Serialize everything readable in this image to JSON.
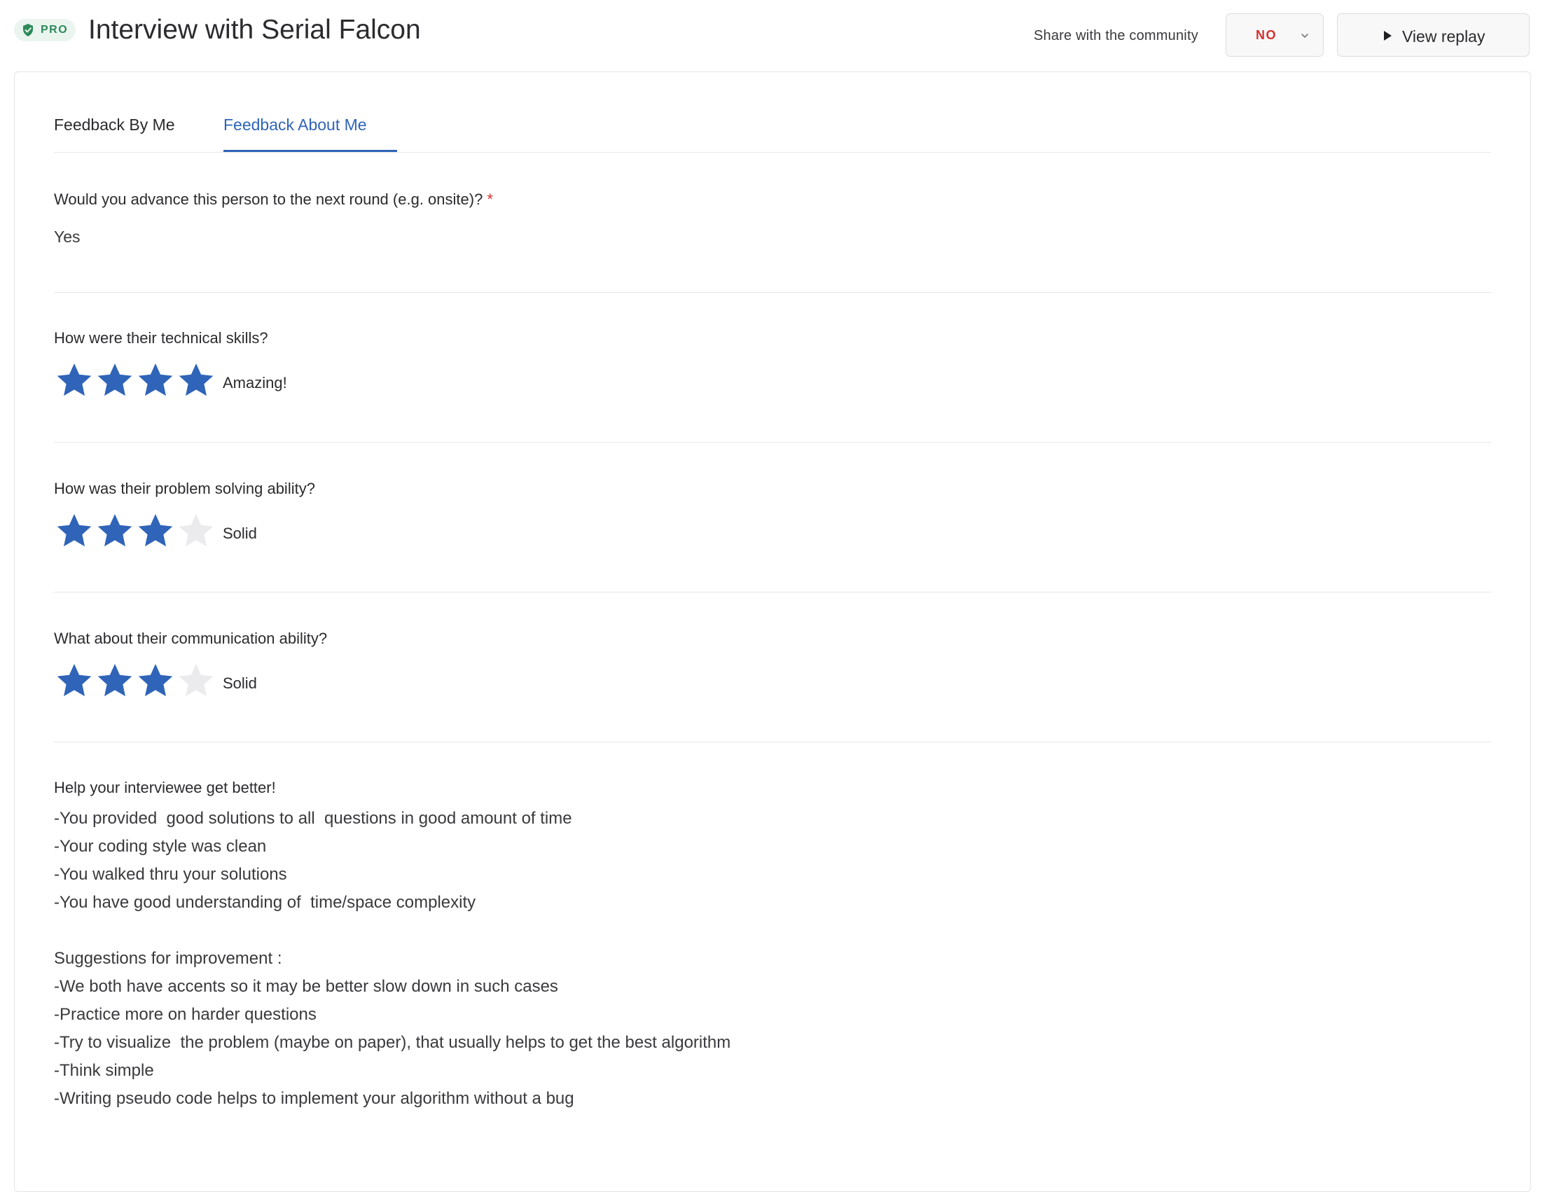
{
  "header": {
    "badge": "PRO",
    "title": "Interview with Serial Falcon",
    "share_label": "Share with the community",
    "share_value": "NO",
    "replay_label": "View replay"
  },
  "tabs": [
    {
      "label": "Feedback By Me",
      "active": false
    },
    {
      "label": "Feedback About Me",
      "active": true
    }
  ],
  "questions": {
    "advance": {
      "label": "Would you advance this person to the next round (e.g. onsite)?",
      "required_mark": "*",
      "answer": "Yes"
    },
    "technical": {
      "label": "How were their technical skills?",
      "rating": 4,
      "max": 4,
      "rating_label": "Amazing!"
    },
    "problem_solving": {
      "label": "How was their problem solving ability?",
      "rating": 3,
      "max": 4,
      "rating_label": "Solid"
    },
    "communication": {
      "label": "What about their communication ability?",
      "rating": 3,
      "max": 4,
      "rating_label": "Solid"
    }
  },
  "help": {
    "label": "Help your interviewee get better!",
    "lines": [
      "-You provided  good solutions to all  questions in good amount of time",
      "-Your coding style was clean",
      "-You walked thru your solutions",
      "-You have good understanding of  time/space complexity",
      "",
      "Suggestions for improvement :",
      "-We both have accents so it may be better slow down in such cases",
      "-Practice more on harder questions",
      "-Try to visualize  the problem (maybe on paper), that usually helps to get the best algorithm",
      "-Think simple",
      "-Writing pseudo code helps to implement your algorithm without a bug"
    ]
  },
  "colors": {
    "accent": "#2f64b8",
    "star_filled": "#2f64b8",
    "star_empty": "#ebebed",
    "danger": "#d7312e",
    "pro_green": "#2d8a5a"
  }
}
